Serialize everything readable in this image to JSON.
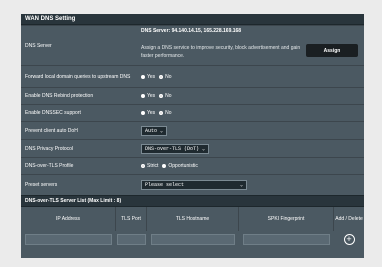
{
  "section_title": "WAN DNS Setting",
  "dns_server": {
    "label": "DNS Server",
    "value": "DNS Server: 94.140.14.15, 165.228.169.168",
    "help": "Assign a DNS service to improve security, block advertisement and gain faster performance.",
    "assign_button": "Assign"
  },
  "forward_local": {
    "label": "Forward local domain queries to upstream DNS",
    "yes": "Yes",
    "no": "No",
    "selected": "No"
  },
  "rebind": {
    "label": "Enable DNS Rebind protection",
    "yes": "Yes",
    "no": "No",
    "selected": "No"
  },
  "dnssec": {
    "label": "Enable DNSSEC support",
    "yes": "Yes",
    "no": "No",
    "selected": "No"
  },
  "prevent_doh": {
    "label": "Prevent client auto DoH",
    "value": "Auto"
  },
  "privacy_protocol": {
    "label": "DNS Privacy Protocol",
    "value": "DNS-over-TLS (DoT)"
  },
  "dot_profile": {
    "label": "DNS-over-TLS Profile",
    "strict": "Strict",
    "opportunistic": "Opportunistic",
    "selected": "Strict"
  },
  "preset": {
    "label": "Preset servers",
    "value": "Please select"
  },
  "server_list": {
    "title": "DNS-over-TLS Server List (Max Limit : 8)",
    "columns": [
      "IP Address",
      "TLS Port",
      "TLS Hostname",
      "SPKI Fingerprint",
      "Add / Delete"
    ]
  },
  "colors": {
    "panel": "#4b5962",
    "header": "#29353c",
    "button": "#1a1f22"
  }
}
